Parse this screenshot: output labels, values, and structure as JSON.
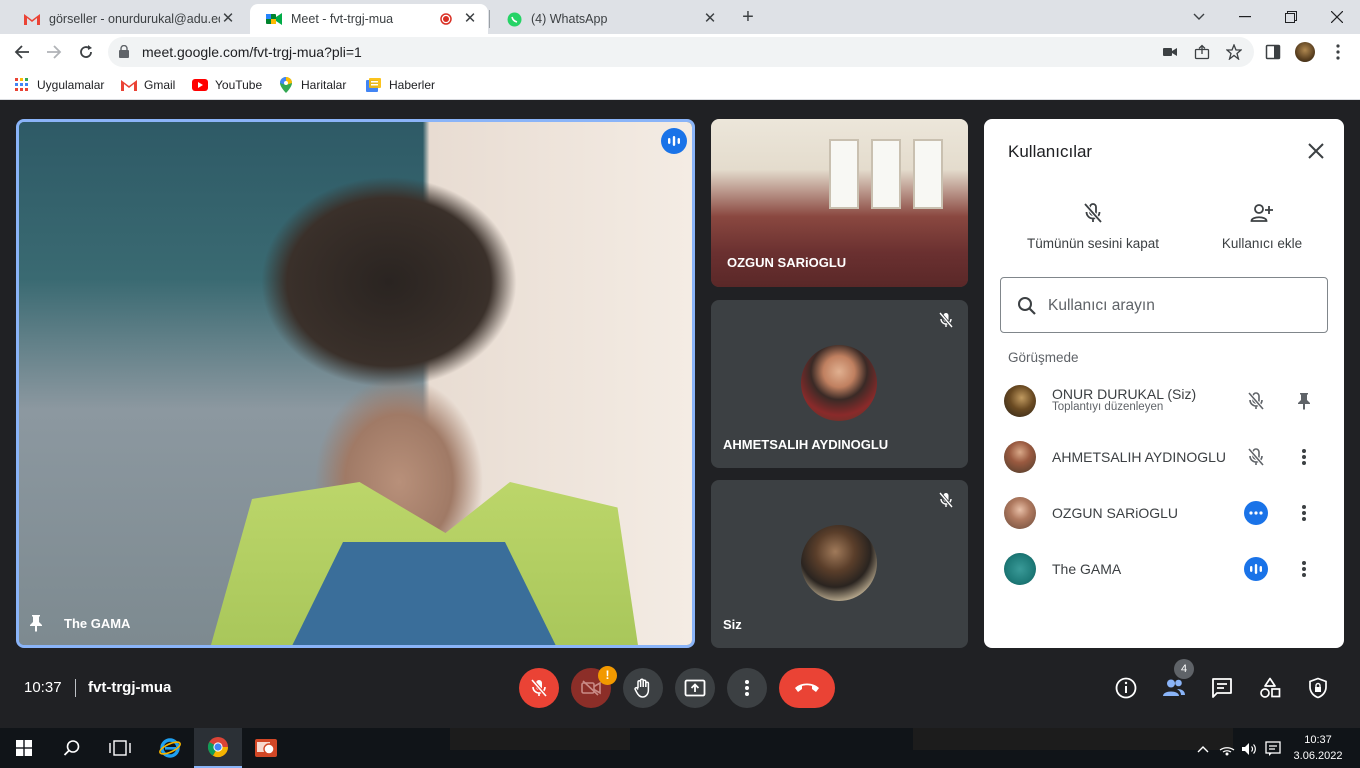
{
  "browser": {
    "tabs": [
      {
        "title": "görseller - onurdurukal@adu.edu",
        "icon": "gmail-icon"
      },
      {
        "title": "Meet - fvt-trgj-mua",
        "icon": "meet-icon",
        "active": true
      },
      {
        "title": "(4) WhatsApp",
        "icon": "whatsapp-icon"
      }
    ],
    "url": "meet.google.com/fvt-trgj-mua?pli=1",
    "bookmarks": [
      "Uygulamalar",
      "Gmail",
      "YouTube",
      "Haritalar",
      "Haberler"
    ]
  },
  "meet": {
    "main_tile": {
      "name": "The GAMA"
    },
    "side_tiles": [
      {
        "name": "OZGUN SARiOGLU"
      },
      {
        "name": "AHMETSALIH AYDINOGLU"
      },
      {
        "name": "Siz"
      }
    ],
    "panel": {
      "title": "Kullanıcılar",
      "mute_all": "Tümünün sesini kapat",
      "add_user": "Kullanıcı ekle",
      "search_placeholder": "Kullanıcı arayın",
      "section": "Görüşmede",
      "people": [
        {
          "name": "ONUR DURUKAL (Siz)",
          "role": "Toplantıyı düzenleyen",
          "status": "muted"
        },
        {
          "name": "AHMETSALIH AYDINOGLU",
          "status": "muted"
        },
        {
          "name": "OZGUN SARiOGLU",
          "status": "idle"
        },
        {
          "name": "The GAMA",
          "status": "speaking"
        }
      ]
    },
    "bottom": {
      "time": "10:37",
      "code": "fvt-trgj-mua",
      "camera_warning": "!",
      "participant_count": "4"
    }
  },
  "taskbar": {
    "time": "10:37",
    "date": "3.06.2022"
  },
  "colors": {
    "accent": "#1a73e8",
    "danger": "#ea4335",
    "warning": "#f29900",
    "meet_bg": "#202124"
  }
}
